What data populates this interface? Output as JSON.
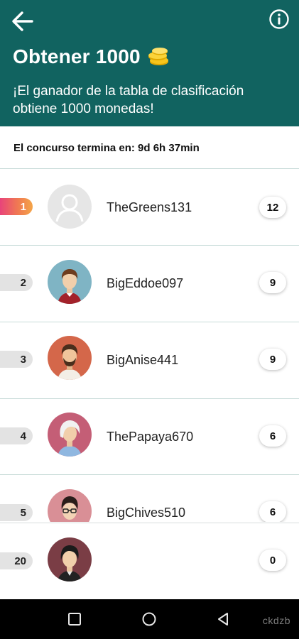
{
  "header": {
    "title": "Obtener 1000",
    "subtitle": "¡El ganador de la tabla de clasificación obtiene 1000 monedas!",
    "background_color": "#116360",
    "icons": {
      "back": "arrow-left-icon",
      "info": "info-icon",
      "coins": "coins-icon"
    }
  },
  "contest": {
    "ends_text": "El concurso termina en: 9d 6h 37min"
  },
  "leaderboard": [
    {
      "rank": "1",
      "username": "TheGreens131",
      "score": "12",
      "avatar": "default-avatar"
    },
    {
      "rank": "2",
      "username": "BigEddoe097",
      "score": "9",
      "avatar": "avatar-man-brown-hair"
    },
    {
      "rank": "3",
      "username": "BigAnise441",
      "score": "9",
      "avatar": "avatar-man-beard"
    },
    {
      "rank": "4",
      "username": "ThePapaya670",
      "score": "6",
      "avatar": "avatar-white-hair"
    },
    {
      "rank": "5",
      "username": "BigChives510",
      "score": "6",
      "avatar": "avatar-glasses"
    }
  ],
  "current_user": {
    "rank": "20",
    "username": "",
    "score": "0",
    "avatar": "avatar-dark-hair"
  },
  "navigation": {
    "icons": [
      "square-icon",
      "circle-icon",
      "triangle-back-icon"
    ]
  },
  "watermark": "ckdzb",
  "colors": {
    "first_place_gradient": [
      "#e8447a",
      "#f4a548"
    ],
    "divider": "#c7dbd8"
  }
}
